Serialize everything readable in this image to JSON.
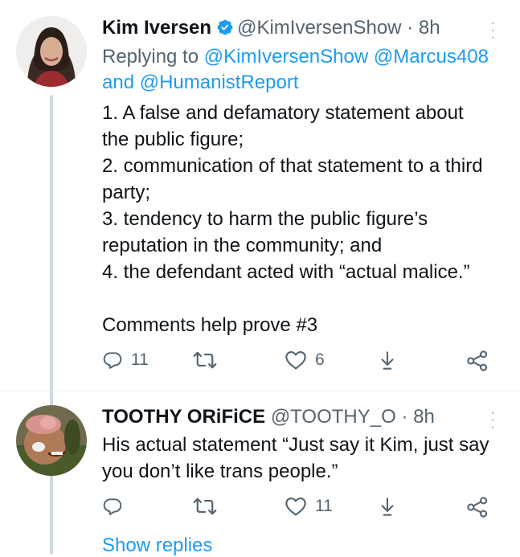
{
  "tweets": [
    {
      "name": "Kim Iversen",
      "handle": "@KimIversenShow",
      "dot": "·",
      "time": "8h",
      "reply_prefix": "Replying to",
      "reply_mentions": [
        "@KimIversenShow",
        "@Marcus408",
        "and",
        "@HumanistReport"
      ],
      "lines": [
        "1. A false and defamatory statement about",
        "the public figure;",
        "2. communication of that statement to a third",
        "party;",
        "3. tendency to harm the public figure’s",
        "reputation in the community; and",
        "4. the defendant acted with “actual malice.”",
        "",
        "Comments help prove #3"
      ],
      "reply_count": "11",
      "retweet_count": "",
      "like_count": "6"
    },
    {
      "name": "TOOTHY ORiFiCE",
      "handle": "@TOOTHY_O",
      "dot": "·",
      "time": "8h",
      "lines": [
        "His actual statement “Just say it Kim, just say",
        "you don’t like trans people.”"
      ],
      "reply_count": "",
      "retweet_count": "",
      "like_count": "11"
    }
  ],
  "show_replies": "Show replies",
  "colors": {
    "accent": "#1d9bf0",
    "muted": "#536471",
    "line": "#cfd9de"
  },
  "icons": [
    "verified-badge-icon",
    "more-icon",
    "reply-icon",
    "retweet-icon",
    "like-icon",
    "bookmark-icon",
    "share-icon"
  ]
}
